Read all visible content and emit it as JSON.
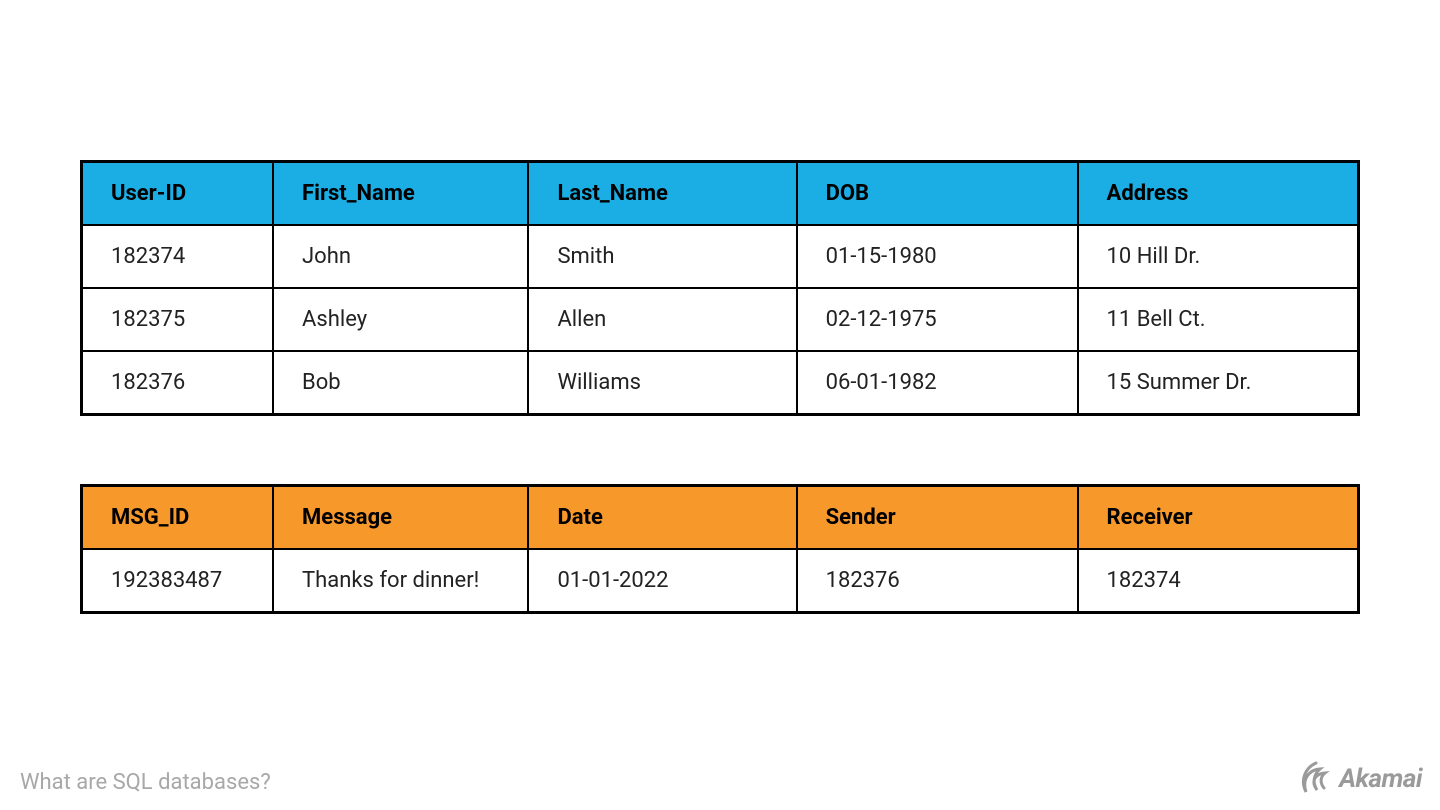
{
  "caption": "What are SQL databases?",
  "brand": "Akamai",
  "colors": {
    "users_header": "#1aaee4",
    "msgs_header": "#f7982a"
  },
  "users_table": {
    "headers": [
      "User-ID",
      "First_Name",
      "Last_Name",
      "DOB",
      "Address"
    ],
    "rows": [
      [
        "182374",
        "John",
        "Smith",
        "01-15-1980",
        "10 Hill Dr."
      ],
      [
        "182375",
        "Ashley",
        "Allen",
        "02-12-1975",
        "11 Bell Ct."
      ],
      [
        "182376",
        "Bob",
        "Williams",
        "06-01-1982",
        "15 Summer Dr."
      ]
    ]
  },
  "msgs_table": {
    "headers": [
      "MSG_ID",
      "Message",
      "Date",
      "Sender",
      "Receiver"
    ],
    "rows": [
      [
        "192383487",
        "Thanks for dinner!",
        "01-01-2022",
        "182376",
        "182374"
      ]
    ]
  },
  "chart_data": [
    {
      "type": "table",
      "title": "Users",
      "columns": [
        "User-ID",
        "First_Name",
        "Last_Name",
        "DOB",
        "Address"
      ],
      "rows": [
        [
          "182374",
          "John",
          "Smith",
          "01-15-1980",
          "10 Hill Dr."
        ],
        [
          "182375",
          "Ashley",
          "Allen",
          "02-12-1975",
          "11 Bell Ct."
        ],
        [
          "182376",
          "Bob",
          "Williams",
          "06-01-1982",
          "15 Summer Dr."
        ]
      ]
    },
    {
      "type": "table",
      "title": "Messages",
      "columns": [
        "MSG_ID",
        "Message",
        "Date",
        "Sender",
        "Receiver"
      ],
      "rows": [
        [
          "192383487",
          "Thanks for dinner!",
          "01-01-2022",
          "182376",
          "182374"
        ]
      ]
    }
  ]
}
